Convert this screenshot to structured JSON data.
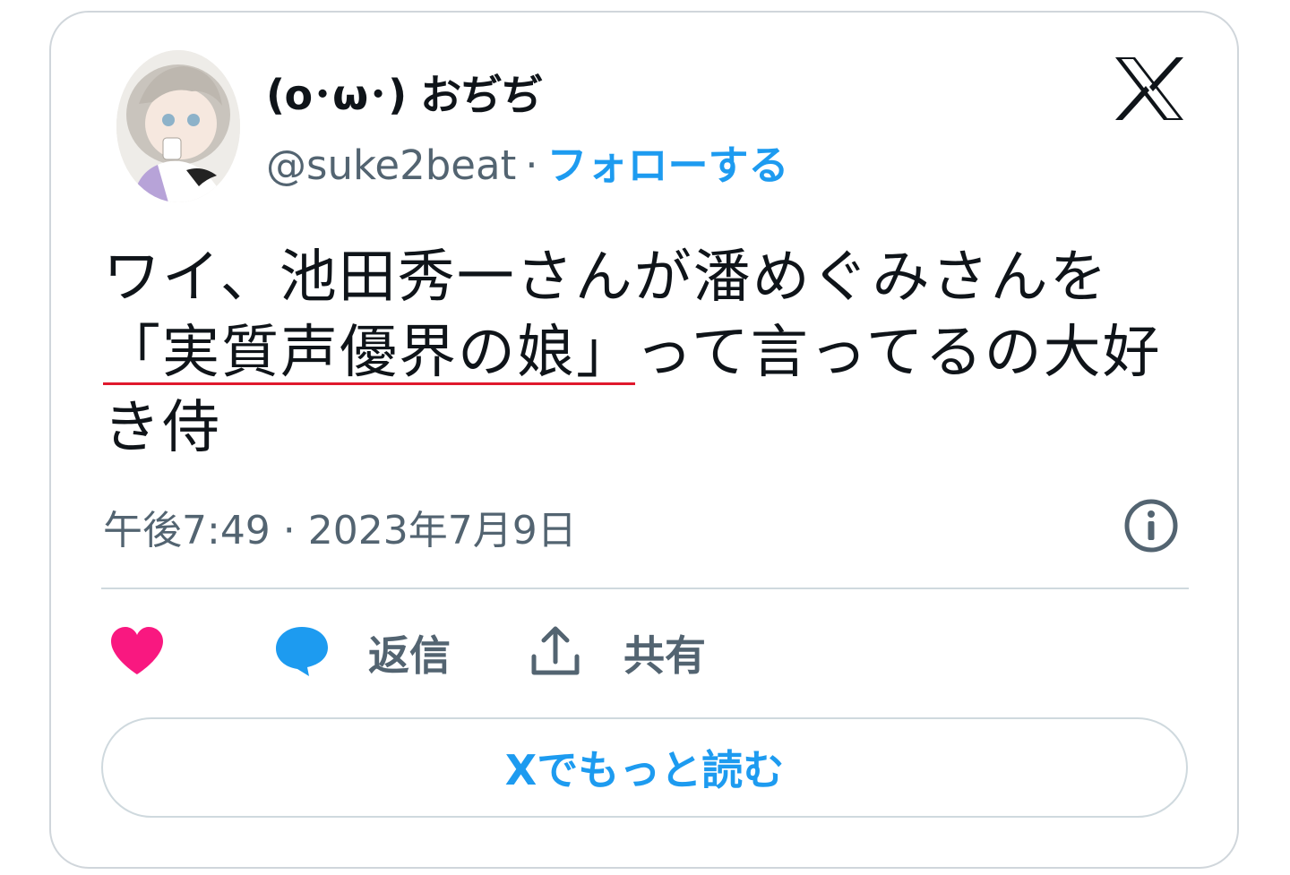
{
  "author": {
    "display_name": "(o･ω･) おぢぢ",
    "handle": "@suke2beat",
    "separator": "·",
    "follow_label": "フォローする"
  },
  "tweet": {
    "text_before": "ワイ、池田秀一さんが潘めぐみさんを",
    "text_underlined": "「実質声優界の娘」",
    "text_after": "って言ってるの大好き侍"
  },
  "meta": {
    "timestamp": "午後7:49 · 2023年7月9日"
  },
  "actions": {
    "reply_label": "返信",
    "share_label": "共有"
  },
  "read_more_label": "Xでもっと読む",
  "colors": {
    "accent": "#1d9bf0",
    "like": "#f91880",
    "text": "#0f1419",
    "secondary_text": "#536471",
    "underline": "#e0182d",
    "border": "#cfd9de"
  },
  "icons": {
    "brand": "x-logo-icon",
    "info": "info-icon",
    "like": "heart-icon",
    "reply": "speech-bubble-icon",
    "share": "share-upload-icon"
  }
}
